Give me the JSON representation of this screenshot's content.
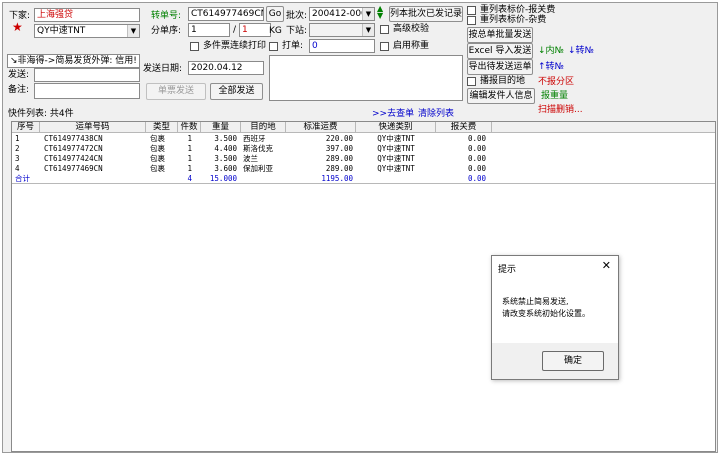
{
  "top": {
    "receiver_label": "下家:",
    "receiver_value": "上海强贷",
    "channel_value": "QY中速TNT",
    "forward_no_label": "转单号:",
    "forward_no_value": "CT614977469CN",
    "go_label": "Go",
    "batch_label": "批次:",
    "batch_value": "200412-000-0",
    "list_sent_label": "列本批次已发记录",
    "split_label": "分单序:",
    "split_cur": "1",
    "split_sep": "/",
    "split_total": "1",
    "kg_label": "KG",
    "station_label": "下站:",
    "verify_label": "高级校验",
    "multi_print_label": "多件票连续打印",
    "print_label": "打单:",
    "print_value": "0",
    "enable_weigh_label": "启用称重",
    "mode_text": "↘非海得->简易发货外弹: 信用!",
    "send_label": "发送:",
    "note_label": "备注:",
    "date_label": "发送日期:",
    "date_value": "2020.04.12",
    "single_send": "单票发送",
    "send_all": "全部发送",
    "dest_label": "播报目的地",
    "no_zone": "不报分区",
    "edit_sender": "编辑发件人信息",
    "report_weight": "报重量",
    "scan_delete": "扫描删销..."
  },
  "right": {
    "recalc_tariff": "重列表标价-报关费",
    "recalc_misc": "重列表标价-杂费",
    "batch_send_all": "按总单批量发送",
    "excel_import": "Excel 导入发送",
    "export_pending": "导出待发送运单",
    "arrow_in": "↓内№",
    "arrow_turn1": "↓转№",
    "arrow_turn2": "↑转№"
  },
  "list": {
    "count_label": "快件列表: 共4件",
    "goto_check": ">>去查单",
    "clear_list": "清除列表",
    "columns": [
      "序号",
      "运单号码",
      "类型",
      "件数",
      "重量",
      "目的地",
      "标准运费",
      "快递类别",
      "报关费"
    ],
    "rows": [
      [
        "1",
        "CT614977438CN",
        "包裹",
        "1",
        "3.500",
        "西班牙",
        "220.00",
        "QY中速TNT",
        "0.00"
      ],
      [
        "2",
        "CT614977472CN",
        "包裹",
        "1",
        "4.400",
        "斯洛伐克",
        "397.00",
        "QY中速TNT",
        "0.00"
      ],
      [
        "3",
        "CT614977424CN",
        "包裹",
        "1",
        "3.500",
        "波兰",
        "289.00",
        "QY中速TNT",
        "0.00"
      ],
      [
        "4",
        "CT614977469CN",
        "包裹",
        "1",
        "3.600",
        "保加利亚",
        "289.00",
        "QY中速TNT",
        "0.00"
      ]
    ],
    "total": {
      "label": "合计",
      "qty": "4",
      "weight": "15.000",
      "freight": "1195.00",
      "fee": "0.00"
    }
  },
  "dialog": {
    "title": "提示",
    "line1": "系统禁止简易发送,",
    "line2": "请改变系统初始化设置。",
    "ok": "确定"
  },
  "colors": {
    "accent_blue": "#0000cc",
    "red": "#cc0000",
    "green": "#008000"
  }
}
